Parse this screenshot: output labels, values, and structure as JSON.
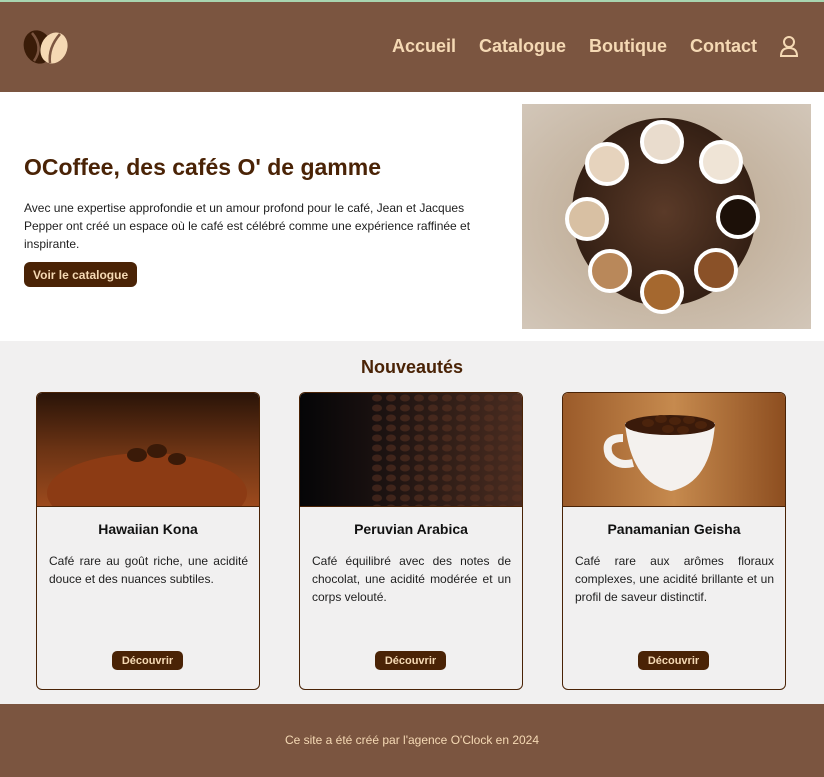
{
  "colors": {
    "header_bg": "#7b5540",
    "accent_text": "#f5d9b4",
    "dark_brown": "#4a2306",
    "section_bg": "#f1f0f0"
  },
  "header": {
    "logo_icon": "coffee-bean-logo",
    "nav": [
      "Accueil",
      "Catalogue",
      "Boutique",
      "Contact"
    ],
    "user_icon": "user-icon"
  },
  "hero": {
    "title": "OCoffee, des cafés O' de gamme",
    "text": "Avec une expertise approfondie et un amour profond pour le café, Jean et Jacques Pepper ont créé un espace où le café est célébré comme une expérience raffinée et inspirante.",
    "button": "Voir le catalogue"
  },
  "news": {
    "title": "Nouveautés",
    "cards": [
      {
        "title": "Hawaiian Kona",
        "text": "Café rare au goût riche, une acidité douce et des nuances subtiles.",
        "button": "Découvrir"
      },
      {
        "title": "Peruvian Arabica",
        "text": "Café équilibré avec des notes de chocolat, une acidité modérée et un corps velouté.",
        "button": "Découvrir"
      },
      {
        "title": "Panamanian Geisha",
        "text": "Café rare aux arômes floraux complexes, une acidité brillante et un profil de saveur distinctif.",
        "button": "Découvrir"
      }
    ]
  },
  "footer": {
    "text": "Ce site a été créé par l'agence O'Clock en 2024"
  }
}
